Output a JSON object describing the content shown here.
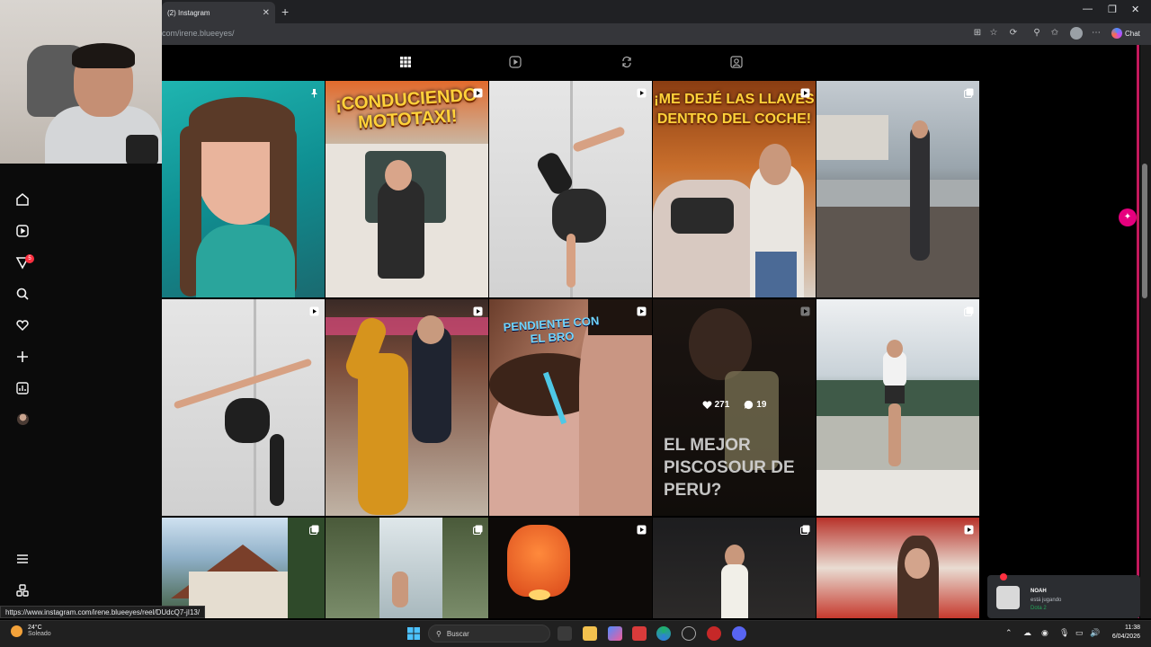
{
  "browser": {
    "tab_title": "(2) Instagram",
    "url": "com/irene.blueeyes/",
    "chat_label": "Chat",
    "status_url": "https://www.instagram.com/irene.blueeyes/reel/DUdcQ7-jI13/"
  },
  "nav": {
    "notifications_badge": "5",
    "items": [
      "home-icon",
      "reels-icon",
      "messages-icon",
      "search-icon",
      "heart-icon",
      "create-icon",
      "dashboard-icon",
      "profile-avatar",
      "menu-icon",
      "more-icon"
    ]
  },
  "profile_tabs": [
    "grid-icon",
    "reels-icon",
    "reposts-icon",
    "tagged-icon"
  ],
  "posts": [
    {
      "type": "pinned",
      "headline": ""
    },
    {
      "type": "reel",
      "headline": "¡CONDUCIENDO MOTOTAXI!"
    },
    {
      "type": "reel",
      "headline": ""
    },
    {
      "type": "reel",
      "headline": "¡ME DEJÉ LAS LLAVES DENTRO DEL COCHE!"
    },
    {
      "type": "carousel",
      "headline": ""
    },
    {
      "type": "reel",
      "headline": ""
    },
    {
      "type": "reel",
      "headline": ""
    },
    {
      "type": "reel",
      "headline": "PENDIENTE CON EL BRO"
    },
    {
      "type": "reel",
      "headline": "EL MEJOR PISCOSOUR DE PERU?",
      "likes": "271",
      "comments": "19"
    },
    {
      "type": "carousel",
      "headline": ""
    },
    {
      "type": "carousel",
      "headline": ""
    },
    {
      "type": "carousel",
      "headline": ""
    },
    {
      "type": "reel",
      "headline": ""
    },
    {
      "type": "carousel",
      "headline": ""
    },
    {
      "type": "reel",
      "headline": ""
    }
  ],
  "toast": {
    "name": "NOAH",
    "status": "está jugando",
    "game": "Dota 2"
  },
  "taskbar": {
    "temperature": "24°C",
    "condition": "Soleado",
    "search_placeholder": "Buscar",
    "time": "11:38",
    "date": "6/04/2026"
  },
  "colors": {
    "accent": "#e6007e",
    "badge": "#ff3040",
    "playing": "#23a559"
  }
}
